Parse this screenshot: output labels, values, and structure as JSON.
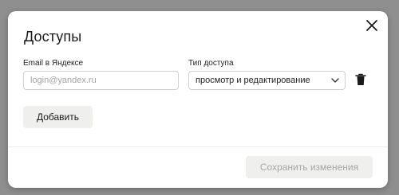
{
  "dialog": {
    "title": "Доступы",
    "close_icon": "close-icon"
  },
  "form": {
    "email_label": "Email в Яндексе",
    "email_value": "",
    "email_placeholder": "login@yandex.ru",
    "access_label": "Тип доступа",
    "access_value": "просмотр и редактирование",
    "access_icon": "chevron-down-icon",
    "delete_icon": "trash-icon"
  },
  "actions": {
    "add_label": "Добавить",
    "save_label": "Сохранить изменения"
  },
  "colors": {
    "overlay": "#8f8f8f",
    "modal_bg": "#ffffff",
    "button_bg": "#efefed",
    "disabled_text": "#a6a6a6",
    "text": "#1a1a1a"
  }
}
